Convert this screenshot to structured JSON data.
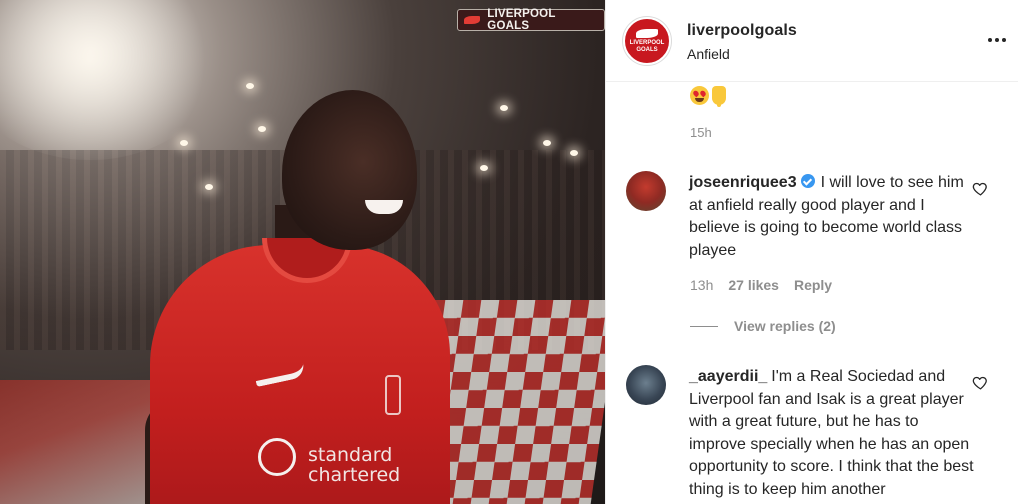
{
  "post": {
    "watermark": "LIVERPOOL GOALS",
    "image_sponsor_text": "standard chartered",
    "account": {
      "username": "liverpoolgoals",
      "location": "Anfield",
      "avatar_text": [
        "LIVERPOOL",
        "GOALS"
      ]
    },
    "caption_time": "15h"
  },
  "comments": [
    {
      "username": "joseenriquee3",
      "verified": true,
      "text": "I will love to see him at anfield really good player and I believe is going to become world class playee",
      "time": "13h",
      "likes": "27 likes",
      "reply_label": "Reply",
      "view_replies": "View replies (2)"
    },
    {
      "username": "_aayerdii_",
      "verified": false,
      "text": "I'm a Real Sociedad and Liverpool fan and Isak is a great player with a great future, but he has to improve specially when he has an open opportunity to score. I think that the best thing is to keep him another"
    }
  ],
  "colors": {
    "brand_red": "#c8181f",
    "verified_blue": "#3897f0",
    "muted_text": "#8e8e8e",
    "text": "#262626"
  }
}
